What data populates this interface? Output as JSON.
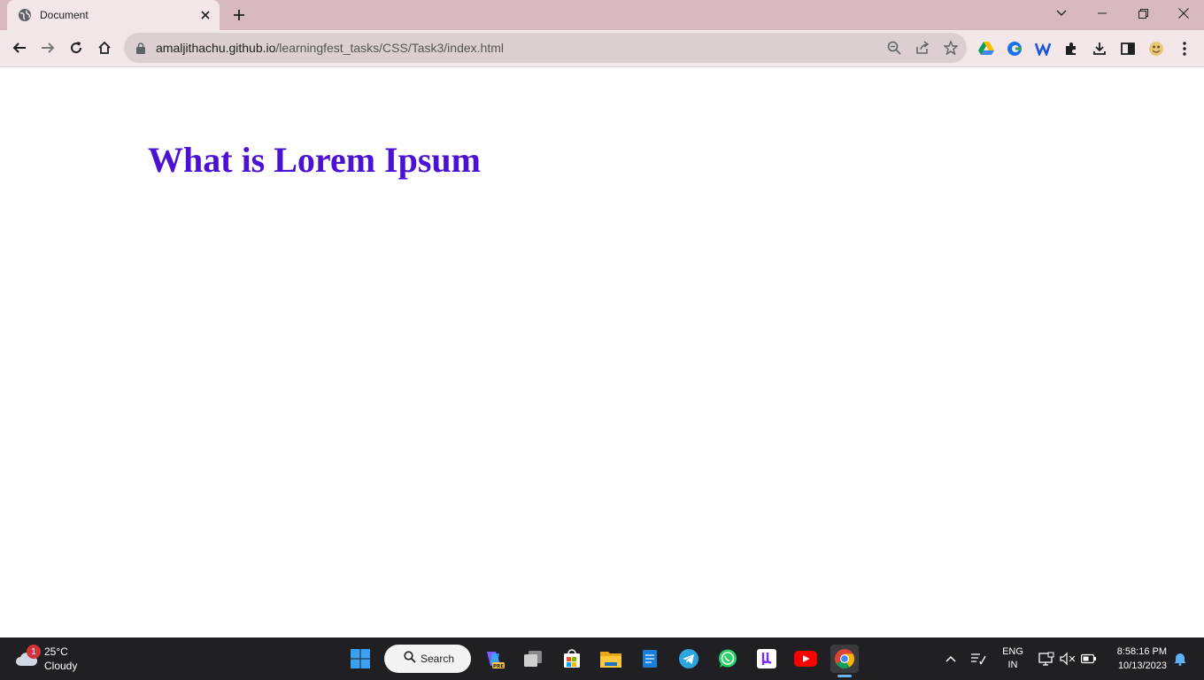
{
  "browser": {
    "tab_title": "Document",
    "url_domain": "amaljithachu.github.io",
    "url_path": "/learningfest_tasks/CSS/Task3/index.html"
  },
  "page": {
    "heading": "What is Lorem Ipsum",
    "heading_color": "#4b12d6"
  },
  "taskbar": {
    "weather_temp": "25°C",
    "weather_desc": "Cloudy",
    "weather_badge": "1",
    "search_label": "Search",
    "lang_line1": "ENG",
    "lang_line2": "IN",
    "time": "8:58:16 PM",
    "date": "10/13/2023",
    "apps": [
      "copilot-pre-icon",
      "task-view-icon",
      "microsoft-store-icon",
      "file-explorer-icon",
      "windows-notepad-icon",
      "telegram-icon",
      "whatsapp-icon",
      "mu-app-icon",
      "youtube-icon",
      "chrome-icon"
    ]
  }
}
